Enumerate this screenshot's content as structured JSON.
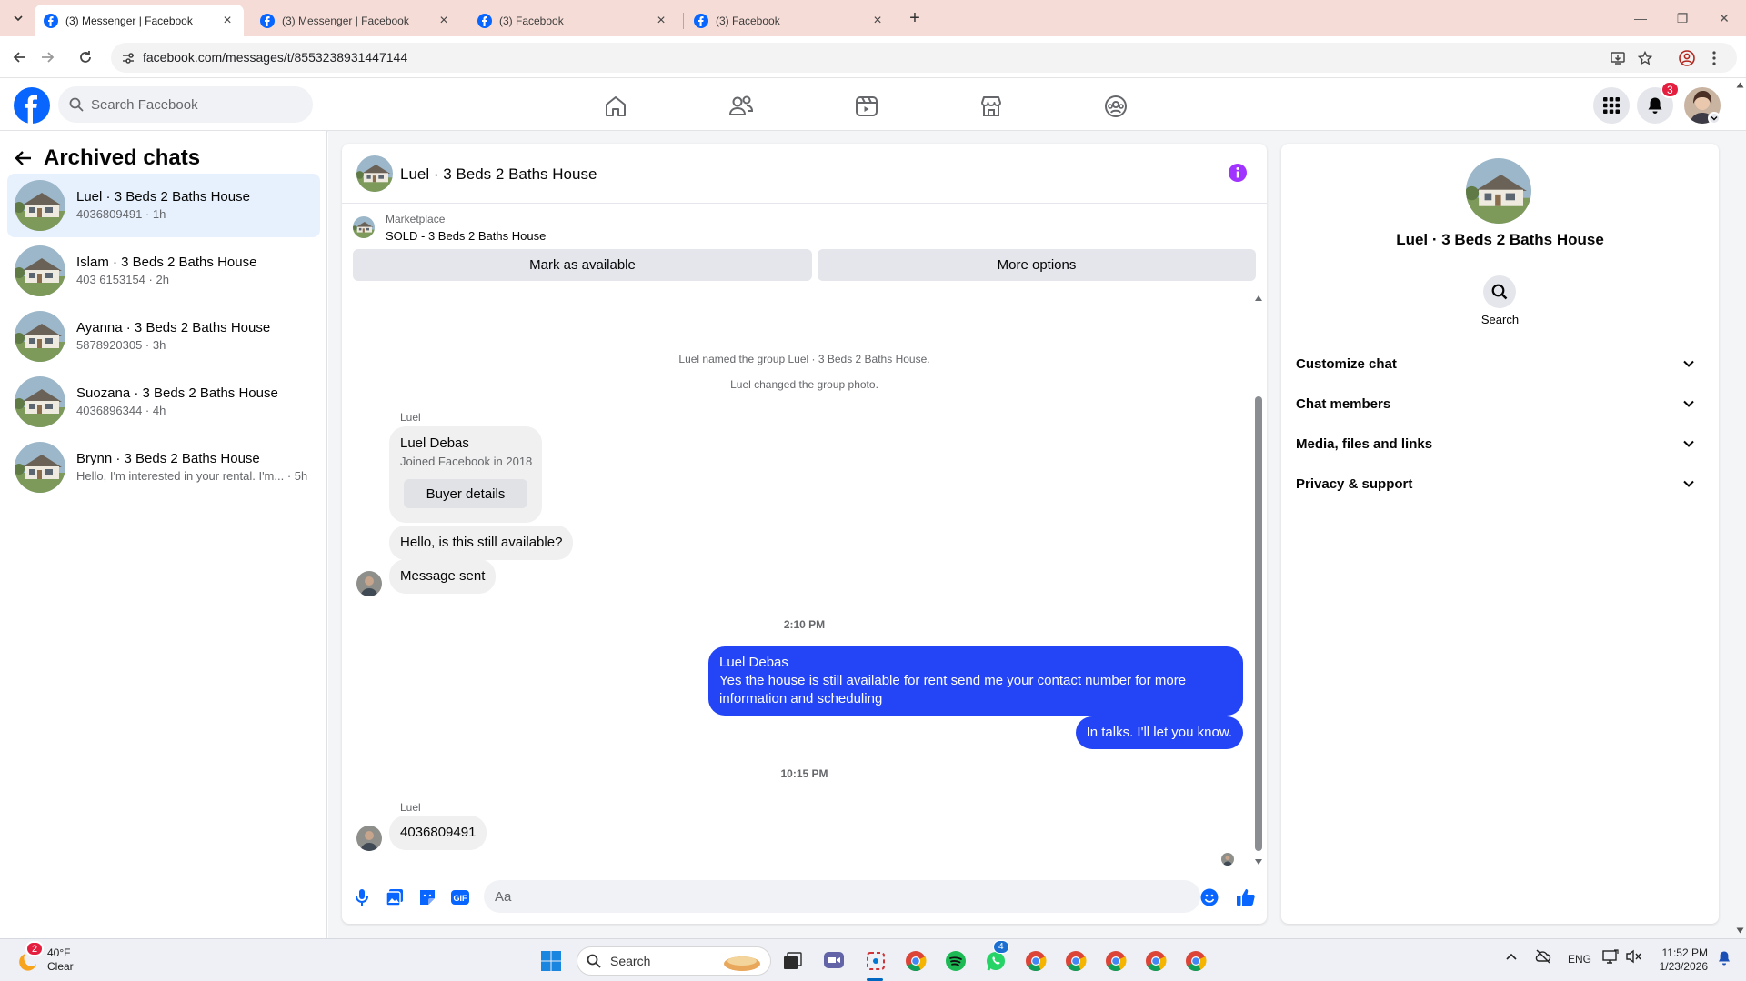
{
  "browser": {
    "tabs": [
      {
        "title": "(3) Messenger | Facebook",
        "active": true
      },
      {
        "title": "(3) Messenger | Facebook",
        "active": false
      },
      {
        "title": "(3) Facebook",
        "active": false
      },
      {
        "title": "(3) Facebook",
        "active": false
      }
    ],
    "url": "facebook.com/messages/t/8553238931447144"
  },
  "fb": {
    "search_placeholder": "Search Facebook",
    "notification_count": "3",
    "brand_color": "#0866ff"
  },
  "left": {
    "title": "Archived chats",
    "chats": [
      {
        "name": "Luel · 3 Beds 2 Baths House",
        "sub": "4036809491 · 1h"
      },
      {
        "name": "Islam · 3 Beds 2 Baths House",
        "sub": "403 6153154 · 2h"
      },
      {
        "name": "Ayanna · 3 Beds 2 Baths House",
        "sub": "5878920305 · 3h"
      },
      {
        "name": "Suozana · 3 Beds 2 Baths House",
        "sub": "4036896344 · 4h"
      },
      {
        "name": "Brynn · 3 Beds 2 Baths House",
        "sub": "Hello, I'm interested in your rental. I'm... · 5h"
      }
    ]
  },
  "chat": {
    "title": "Luel · 3 Beds 2 Baths House",
    "marketplace_label": "Marketplace",
    "marketplace_title": "SOLD - 3 Beds 2 Baths House",
    "mark_available": "Mark as available",
    "more_options": "More options",
    "sys1": "Luel named the group Luel · 3 Beds 2 Baths House.",
    "sys2": "Luel changed the group photo.",
    "sender": "Luel",
    "profile_name": "Luel Debas",
    "profile_joined": "Joined Facebook in 2018",
    "buyer_details": "Buyer details",
    "msg1": "Hello, is this still available?",
    "msg2": "Message sent",
    "time1": "2:10 PM",
    "out1_name": "Luel Debas",
    "out1_text": "Yes the house is still available for rent send me your contact number for more information and scheduling",
    "out2": "In talks. I'll let you know.",
    "time2": "10:15 PM",
    "msg3": "4036809491",
    "composer_placeholder": "Aa",
    "accent": "#2445f5"
  },
  "right": {
    "title": "Luel · 3 Beds 2 Baths House",
    "search_label": "Search",
    "rows": [
      "Customize chat",
      "Chat members",
      "Media, files and links",
      "Privacy & support"
    ]
  },
  "taskbar": {
    "weather_temp": "40°F",
    "weather_desc": "Clear",
    "weather_badge": "2",
    "search_label": "Search",
    "whatsapp_badge": "4",
    "lang": "ENG",
    "time": "11:52 PM",
    "date": "1/23/2026"
  }
}
